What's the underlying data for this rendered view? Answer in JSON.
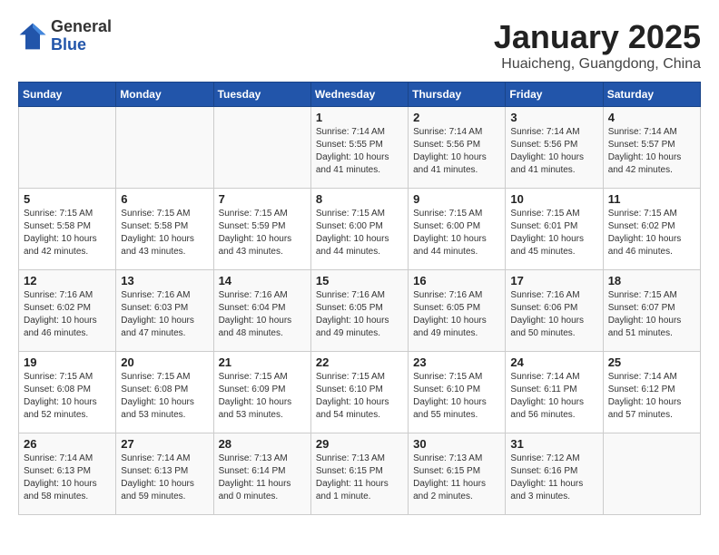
{
  "header": {
    "logo_general": "General",
    "logo_blue": "Blue",
    "title": "January 2025",
    "location": "Huaicheng, Guangdong, China"
  },
  "weekdays": [
    "Sunday",
    "Monday",
    "Tuesday",
    "Wednesday",
    "Thursday",
    "Friday",
    "Saturday"
  ],
  "weeks": [
    [
      {
        "day": "",
        "info": ""
      },
      {
        "day": "",
        "info": ""
      },
      {
        "day": "",
        "info": ""
      },
      {
        "day": "1",
        "info": "Sunrise: 7:14 AM\nSunset: 5:55 PM\nDaylight: 10 hours\nand 41 minutes."
      },
      {
        "day": "2",
        "info": "Sunrise: 7:14 AM\nSunset: 5:56 PM\nDaylight: 10 hours\nand 41 minutes."
      },
      {
        "day": "3",
        "info": "Sunrise: 7:14 AM\nSunset: 5:56 PM\nDaylight: 10 hours\nand 41 minutes."
      },
      {
        "day": "4",
        "info": "Sunrise: 7:14 AM\nSunset: 5:57 PM\nDaylight: 10 hours\nand 42 minutes."
      }
    ],
    [
      {
        "day": "5",
        "info": "Sunrise: 7:15 AM\nSunset: 5:58 PM\nDaylight: 10 hours\nand 42 minutes."
      },
      {
        "day": "6",
        "info": "Sunrise: 7:15 AM\nSunset: 5:58 PM\nDaylight: 10 hours\nand 43 minutes."
      },
      {
        "day": "7",
        "info": "Sunrise: 7:15 AM\nSunset: 5:59 PM\nDaylight: 10 hours\nand 43 minutes."
      },
      {
        "day": "8",
        "info": "Sunrise: 7:15 AM\nSunset: 6:00 PM\nDaylight: 10 hours\nand 44 minutes."
      },
      {
        "day": "9",
        "info": "Sunrise: 7:15 AM\nSunset: 6:00 PM\nDaylight: 10 hours\nand 44 minutes."
      },
      {
        "day": "10",
        "info": "Sunrise: 7:15 AM\nSunset: 6:01 PM\nDaylight: 10 hours\nand 45 minutes."
      },
      {
        "day": "11",
        "info": "Sunrise: 7:15 AM\nSunset: 6:02 PM\nDaylight: 10 hours\nand 46 minutes."
      }
    ],
    [
      {
        "day": "12",
        "info": "Sunrise: 7:16 AM\nSunset: 6:02 PM\nDaylight: 10 hours\nand 46 minutes."
      },
      {
        "day": "13",
        "info": "Sunrise: 7:16 AM\nSunset: 6:03 PM\nDaylight: 10 hours\nand 47 minutes."
      },
      {
        "day": "14",
        "info": "Sunrise: 7:16 AM\nSunset: 6:04 PM\nDaylight: 10 hours\nand 48 minutes."
      },
      {
        "day": "15",
        "info": "Sunrise: 7:16 AM\nSunset: 6:05 PM\nDaylight: 10 hours\nand 49 minutes."
      },
      {
        "day": "16",
        "info": "Sunrise: 7:16 AM\nSunset: 6:05 PM\nDaylight: 10 hours\nand 49 minutes."
      },
      {
        "day": "17",
        "info": "Sunrise: 7:16 AM\nSunset: 6:06 PM\nDaylight: 10 hours\nand 50 minutes."
      },
      {
        "day": "18",
        "info": "Sunrise: 7:15 AM\nSunset: 6:07 PM\nDaylight: 10 hours\nand 51 minutes."
      }
    ],
    [
      {
        "day": "19",
        "info": "Sunrise: 7:15 AM\nSunset: 6:08 PM\nDaylight: 10 hours\nand 52 minutes."
      },
      {
        "day": "20",
        "info": "Sunrise: 7:15 AM\nSunset: 6:08 PM\nDaylight: 10 hours\nand 53 minutes."
      },
      {
        "day": "21",
        "info": "Sunrise: 7:15 AM\nSunset: 6:09 PM\nDaylight: 10 hours\nand 53 minutes."
      },
      {
        "day": "22",
        "info": "Sunrise: 7:15 AM\nSunset: 6:10 PM\nDaylight: 10 hours\nand 54 minutes."
      },
      {
        "day": "23",
        "info": "Sunrise: 7:15 AM\nSunset: 6:10 PM\nDaylight: 10 hours\nand 55 minutes."
      },
      {
        "day": "24",
        "info": "Sunrise: 7:14 AM\nSunset: 6:11 PM\nDaylight: 10 hours\nand 56 minutes."
      },
      {
        "day": "25",
        "info": "Sunrise: 7:14 AM\nSunset: 6:12 PM\nDaylight: 10 hours\nand 57 minutes."
      }
    ],
    [
      {
        "day": "26",
        "info": "Sunrise: 7:14 AM\nSunset: 6:13 PM\nDaylight: 10 hours\nand 58 minutes."
      },
      {
        "day": "27",
        "info": "Sunrise: 7:14 AM\nSunset: 6:13 PM\nDaylight: 10 hours\nand 59 minutes."
      },
      {
        "day": "28",
        "info": "Sunrise: 7:13 AM\nSunset: 6:14 PM\nDaylight: 11 hours\nand 0 minutes."
      },
      {
        "day": "29",
        "info": "Sunrise: 7:13 AM\nSunset: 6:15 PM\nDaylight: 11 hours\nand 1 minute."
      },
      {
        "day": "30",
        "info": "Sunrise: 7:13 AM\nSunset: 6:15 PM\nDaylight: 11 hours\nand 2 minutes."
      },
      {
        "day": "31",
        "info": "Sunrise: 7:12 AM\nSunset: 6:16 PM\nDaylight: 11 hours\nand 3 minutes."
      },
      {
        "day": "",
        "info": ""
      }
    ]
  ]
}
